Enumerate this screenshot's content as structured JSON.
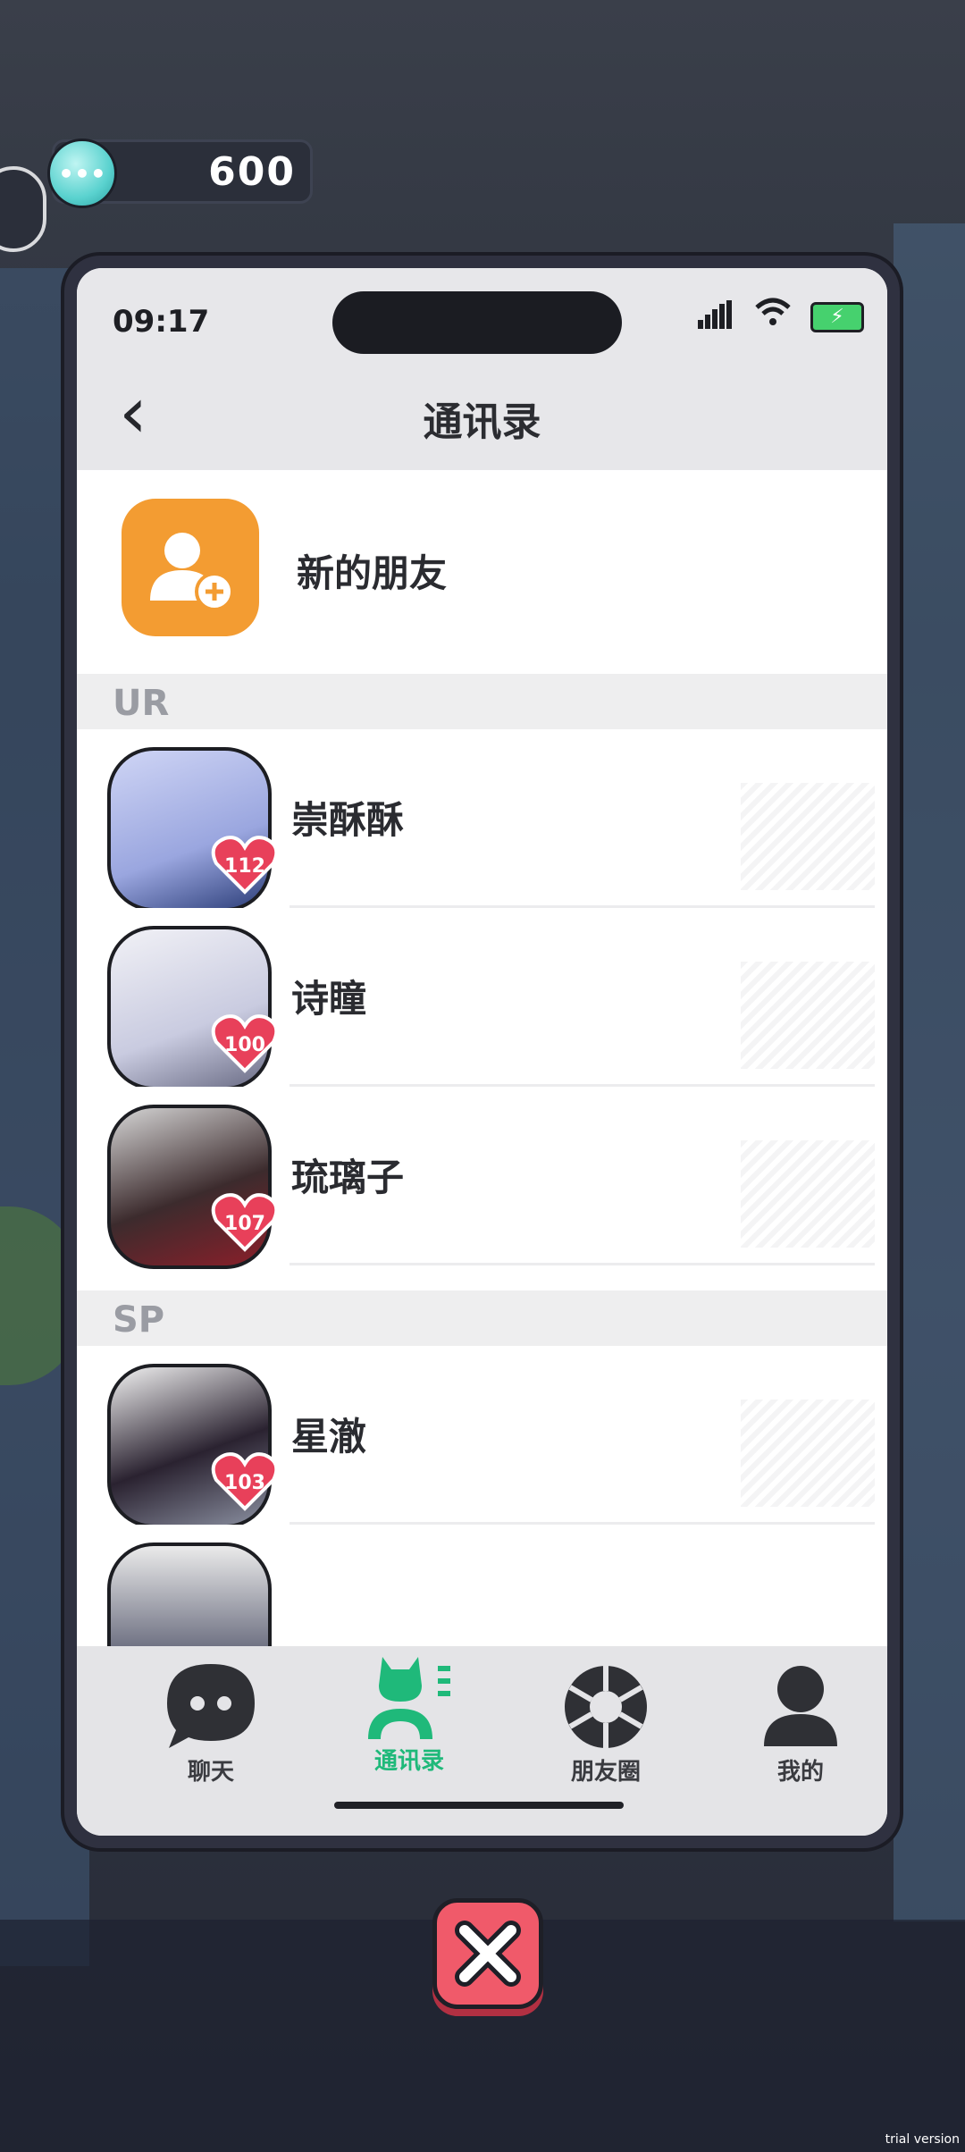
{
  "hud": {
    "currency_amount": "600"
  },
  "status": {
    "time": "09:17"
  },
  "header": {
    "title": "通讯录"
  },
  "new_friend": {
    "label": "新的朋友"
  },
  "sections": [
    {
      "header": "UR",
      "contacts": [
        {
          "name": "崇酥酥",
          "affection": "112"
        },
        {
          "name": "诗瞳",
          "affection": "100"
        },
        {
          "name": "琉璃子",
          "affection": "107"
        }
      ]
    },
    {
      "header": "SP",
      "contacts": [
        {
          "name": "星澈",
          "affection": "103"
        }
      ]
    }
  ],
  "tabs": [
    {
      "label": "聊天",
      "icon": "chat-bubble-icon"
    },
    {
      "label": "通讯录",
      "icon": "contacts-icon",
      "active": true
    },
    {
      "label": "朋友圈",
      "icon": "aperture-icon"
    },
    {
      "label": "我的",
      "icon": "person-icon"
    }
  ],
  "footer": {
    "watermark": "trial version"
  },
  "colors": {
    "accent": "#1fb97a",
    "orange": "#f39c32",
    "heart": "#e8405a"
  }
}
